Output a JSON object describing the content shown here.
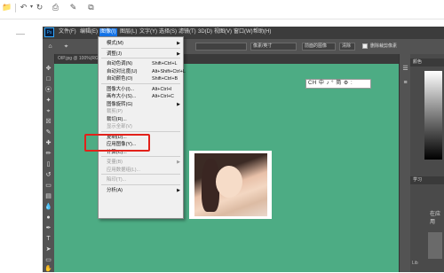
{
  "word_toolbar": {
    "icons": [
      "folder-icon",
      "undo-icon",
      "undo-dropdown-icon",
      "redo-icon",
      "print-preview-icon",
      "format-painter-icon",
      "copy-icon"
    ]
  },
  "ps": {
    "menubar": [
      "文件(F)",
      "编辑(E)",
      "图像(I)",
      "图层(L)",
      "文字(Y)",
      "选择(S)",
      "滤镜(T)",
      "3D(D)",
      "视图(V)",
      "窗口(W)",
      "帮助(H)"
    ],
    "options": {
      "field_size": "8/像素",
      "height_unit": "像素/英寸",
      "clear_button": "前面的图像",
      "clear_label": "清除",
      "checkbox_label": "删除裁剪像素"
    },
    "tab_label": "OIP.jpg @ 100%(RGB/8)",
    "right_panel": {
      "color_tab": "颜色",
      "learn_tab": "学习",
      "learn_text": "在应用",
      "other_text": "Lib"
    }
  },
  "ime_bar": "CH 中 ♪ ° 简 ⚙ :",
  "image_menu": [
    {
      "label": "模式(M)",
      "shortcut": "",
      "arrow": true,
      "disabled": false
    },
    {
      "sep": true
    },
    {
      "label": "调整(J)",
      "shortcut": "",
      "arrow": true,
      "disabled": false
    },
    {
      "sep": true
    },
    {
      "label": "自动色调(N)",
      "shortcut": "Shift+Ctrl+L",
      "arrow": false,
      "disabled": false
    },
    {
      "label": "自动对比度(U)",
      "shortcut": "Alt+Shift+Ctrl+L",
      "arrow": false,
      "disabled": false
    },
    {
      "label": "自动颜色(O)",
      "shortcut": "Shift+Ctrl+B",
      "arrow": false,
      "disabled": false
    },
    {
      "sep": true
    },
    {
      "label": "图像大小(I)...",
      "shortcut": "Alt+Ctrl+I",
      "arrow": false,
      "disabled": false
    },
    {
      "label": "画布大小(S)...",
      "shortcut": "Alt+Ctrl+C",
      "arrow": false,
      "disabled": false
    },
    {
      "label": "图像旋转(G)",
      "shortcut": "",
      "arrow": true,
      "disabled": false
    },
    {
      "label": "裁剪(P)",
      "shortcut": "",
      "arrow": false,
      "disabled": true
    },
    {
      "label": "裁切(R)...",
      "shortcut": "",
      "arrow": false,
      "disabled": false
    },
    {
      "label": "显示全部(V)",
      "shortcut": "",
      "arrow": false,
      "disabled": true
    },
    {
      "sep": true
    },
    {
      "label": "复制(D)...",
      "shortcut": "",
      "arrow": false,
      "disabled": false
    },
    {
      "label": "应用图像(Y)...",
      "shortcut": "",
      "arrow": false,
      "disabled": false
    },
    {
      "label": "计算(C)...",
      "shortcut": "",
      "arrow": false,
      "disabled": false
    },
    {
      "sep": true
    },
    {
      "label": "变量(B)",
      "shortcut": "",
      "arrow": true,
      "disabled": true
    },
    {
      "label": "应用数据组(L)...",
      "shortcut": "",
      "arrow": false,
      "disabled": true
    },
    {
      "sep": true
    },
    {
      "label": "陷印(T)...",
      "shortcut": "",
      "arrow": false,
      "disabled": true
    },
    {
      "sep": true
    },
    {
      "label": "分析(A)",
      "shortcut": "",
      "arrow": true,
      "disabled": false
    }
  ],
  "colors": {
    "canvas": "#4dac84",
    "highlight": "#e2211a",
    "menubar": "#3c3c3c"
  }
}
